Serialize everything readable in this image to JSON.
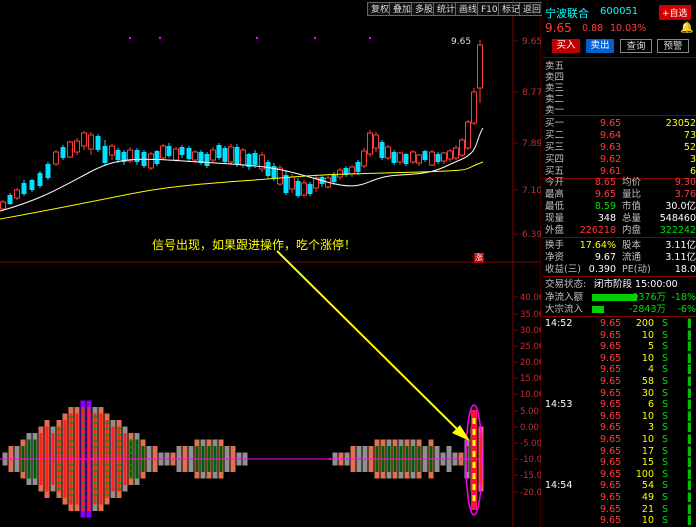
{
  "toolbar": {
    "buttons": [
      "复权",
      "叠加",
      "多股",
      "统计",
      "画线",
      "F10",
      "标记",
      "返回"
    ]
  },
  "price_axis": [
    "9.65",
    "8.77",
    "7.89",
    "7.10",
    "6.39"
  ],
  "price_callout": "9.65",
  "signal_text": "信号出现，如果跟进操作，吃个涨停！",
  "limit_marker": "涨",
  "indicator_axis": [
    "40.00",
    "35.00",
    "30.00",
    "25.00",
    "20.00",
    "15.00",
    "10.00",
    "5.00",
    "0.00",
    "-5.00",
    "-10.00",
    "-15.00",
    "-20.00"
  ],
  "stock": {
    "name": "宁波联合",
    "code": "600051",
    "self_select": "+自选",
    "price": "9.65",
    "change": "0.88",
    "pct": "10.03%",
    "actions": [
      "买入",
      "卖出",
      "查询",
      "预警"
    ]
  },
  "orderbook": {
    "asks": [
      {
        "label": "卖五",
        "price": "",
        "vol": ""
      },
      {
        "label": "卖四",
        "price": "",
        "vol": ""
      },
      {
        "label": "卖三",
        "price": "",
        "vol": ""
      },
      {
        "label": "卖二",
        "price": "",
        "vol": ""
      },
      {
        "label": "卖一",
        "price": "",
        "vol": ""
      }
    ],
    "bids": [
      {
        "label": "买一",
        "price": "9.65",
        "vol": "23052"
      },
      {
        "label": "买二",
        "price": "9.64",
        "vol": "73"
      },
      {
        "label": "买三",
        "price": "9.63",
        "vol": "52"
      },
      {
        "label": "买四",
        "price": "9.62",
        "vol": "3"
      },
      {
        "label": "买五",
        "price": "9.61",
        "vol": "6"
      }
    ]
  },
  "stats": [
    {
      "l1": "今开",
      "v1": "8.65",
      "c1": "red",
      "l2": "均价",
      "v2": "9.30",
      "c2": "red"
    },
    {
      "l1": "最高",
      "v1": "9.65",
      "c1": "red",
      "l2": "量比",
      "v2": "3.76",
      "c2": "red"
    },
    {
      "l1": "最低",
      "v1": "8.59",
      "c1": "green",
      "l2": "市值",
      "v2": "30.0亿",
      "c2": "white"
    },
    {
      "l1": "现量",
      "v1": "348",
      "c1": "white",
      "l2": "总量",
      "v2": "548460",
      "c2": "white"
    },
    {
      "l1": "外盘",
      "v1": "226218",
      "c1": "red",
      "l2": "内盘",
      "v2": "322242",
      "c2": "green"
    }
  ],
  "stats2": [
    {
      "l1": "换手",
      "v1": "17.64%",
      "c1": "yellow",
      "l2": "股本",
      "v2": "3.11亿",
      "c2": "white"
    },
    {
      "l1": "净资",
      "v1": "9.67",
      "c1": "white",
      "l2": "流通",
      "v2": "3.11亿",
      "c2": "white"
    },
    {
      "l1": "收益(三)",
      "v1": "0.390",
      "c1": "white",
      "l2": "PE(动)",
      "v2": "18.0",
      "c2": "white"
    }
  ],
  "trade_status": {
    "label": "交易状态:",
    "value": "闭市阶段 15:00:00"
  },
  "flows": [
    {
      "label": "净流入额",
      "value": "-9376万",
      "pct": "-18%"
    },
    {
      "label": "大宗流入",
      "value": "-2843万",
      "pct": "-6%"
    }
  ],
  "ticks": [
    {
      "time": "14:52",
      "price": "9.65",
      "vol": "200",
      "dir": "S"
    },
    {
      "time": "",
      "price": "9.65",
      "vol": "10",
      "dir": "S"
    },
    {
      "time": "",
      "price": "9.65",
      "vol": "5",
      "dir": "S"
    },
    {
      "time": "",
      "price": "9.65",
      "vol": "10",
      "dir": "S"
    },
    {
      "time": "",
      "price": "9.65",
      "vol": "4",
      "dir": "S"
    },
    {
      "time": "",
      "price": "9.65",
      "vol": "58",
      "dir": "S"
    },
    {
      "time": "",
      "price": "9.65",
      "vol": "30",
      "dir": "S"
    },
    {
      "time": "14:53",
      "price": "9.65",
      "vol": "6",
      "dir": "S"
    },
    {
      "time": "",
      "price": "9.65",
      "vol": "10",
      "dir": "S"
    },
    {
      "time": "",
      "price": "9.65",
      "vol": "3",
      "dir": "S"
    },
    {
      "time": "",
      "price": "9.65",
      "vol": "10",
      "dir": "S"
    },
    {
      "time": "",
      "price": "9.65",
      "vol": "17",
      "dir": "S"
    },
    {
      "time": "",
      "price": "9.65",
      "vol": "15",
      "dir": "S"
    },
    {
      "time": "",
      "price": "9.65",
      "vol": "100",
      "dir": "S"
    },
    {
      "time": "14:54",
      "price": "9.65",
      "vol": "54",
      "dir": "S"
    },
    {
      "time": "",
      "price": "9.65",
      "vol": "49",
      "dir": "S"
    },
    {
      "time": "",
      "price": "9.65",
      "vol": "21",
      "dir": "S"
    },
    {
      "time": "",
      "price": "9.65",
      "vol": "10",
      "dir": "S"
    }
  ]
}
